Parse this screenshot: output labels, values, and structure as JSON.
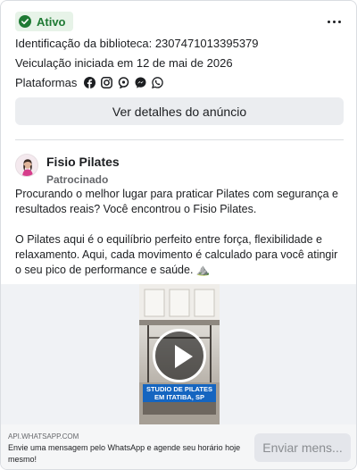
{
  "status": {
    "label": "Ativo",
    "color": "#1f7a34",
    "icon": "check-circle-icon"
  },
  "more_menu_icon": "more-horizontal-icon",
  "meta": {
    "library_id": "Identificação da biblioteca: 2307471013395379",
    "run_start": "Veiculação iniciada em 12 de mai de 2026"
  },
  "platforms": {
    "label": "Plataformas",
    "icons": [
      "facebook-icon",
      "instagram-icon",
      "audience-network-icon",
      "messenger-icon",
      "whatsapp-icon"
    ]
  },
  "details_button": "Ver detalhes do anúncio",
  "advertiser": {
    "name": "Fisio Pilates",
    "sponsored": "Patrocinado"
  },
  "ad_text": {
    "paragraph1": "Procurando o melhor lugar para praticar Pilates com segurança e resultados reais? Você encontrou o Fisio Pilates.",
    "paragraph2": "O Pilates aqui é o equilíbrio perfeito entre força, flexibilidade e relaxamento. Aqui, cada movimento é calculado para você atingir o seu pico de performance e saúde. ⛰️",
    "ellipsis": "..."
  },
  "video": {
    "caption": "STUDIO DE PILATES EM ITATIBA, SP",
    "play_icon": "play-icon"
  },
  "footer": {
    "domain": "API.WHATSAPP.COM",
    "text": "Envie uma mensagem pelo WhatsApp e agende seu horário hoje mesmo!",
    "cta": "Enviar mens..."
  }
}
